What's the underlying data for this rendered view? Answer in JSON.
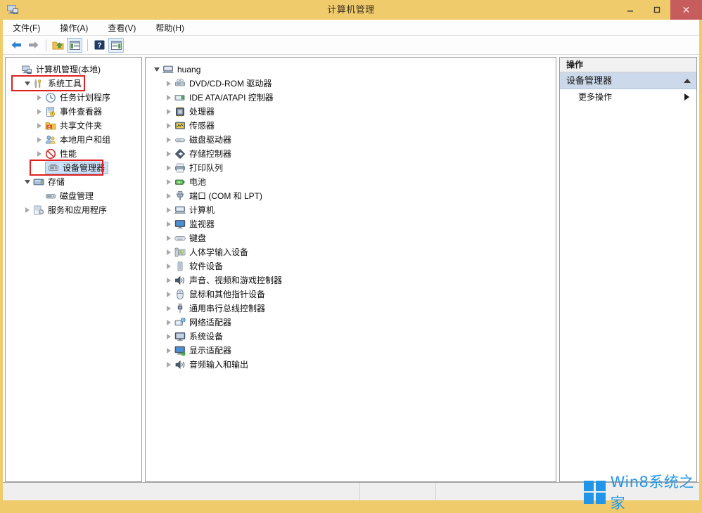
{
  "window": {
    "title": "计算机管理",
    "app_icon": "computer-management-icon",
    "minimize_label": "–",
    "maximize_label": "❐",
    "close_label": "✕",
    "titlebar_color": "#f0cb6b",
    "close_button_color": "#c75c5c"
  },
  "menubar": {
    "items": [
      {
        "label": "文件(F)",
        "name": "menu-file"
      },
      {
        "label": "操作(A)",
        "name": "menu-action"
      },
      {
        "label": "查看(V)",
        "name": "menu-view"
      },
      {
        "label": "帮助(H)",
        "name": "menu-help"
      }
    ]
  },
  "toolbar": {
    "buttons": [
      {
        "icon": "back-arrow-icon",
        "label": ""
      },
      {
        "icon": "forward-arrow-icon",
        "label": ""
      },
      {
        "icon": "up-folder-icon",
        "label": ""
      },
      {
        "icon": "show-hide-tree-icon",
        "label": ""
      },
      {
        "icon": "help-icon",
        "label": ""
      },
      {
        "icon": "show-action-pane-icon",
        "label": ""
      }
    ]
  },
  "tree_left": {
    "root": {
      "label": "计算机管理(本地)",
      "icon": "computer-icon",
      "indent": 0,
      "expander": "none"
    },
    "items": [
      {
        "label": "系统工具",
        "icon": "tools-icon",
        "indent": 1,
        "expander": "expanded",
        "highlight": "red-box"
      },
      {
        "label": "任务计划程序",
        "icon": "clock-icon",
        "indent": 2,
        "expander": "collapsed"
      },
      {
        "label": "事件查看器",
        "icon": "event-viewer-icon",
        "indent": 2,
        "expander": "collapsed"
      },
      {
        "label": "共享文件夹",
        "icon": "shared-folder-icon",
        "indent": 2,
        "expander": "collapsed"
      },
      {
        "label": "本地用户和组",
        "icon": "users-icon",
        "indent": 2,
        "expander": "collapsed"
      },
      {
        "label": "性能",
        "icon": "performance-icon",
        "indent": 2,
        "expander": "collapsed"
      },
      {
        "label": "设备管理器",
        "icon": "device-manager-icon",
        "indent": 2,
        "expander": "none",
        "selected": true,
        "highlight": "red-box"
      },
      {
        "label": "存储",
        "icon": "storage-icon",
        "indent": 1,
        "expander": "expanded"
      },
      {
        "label": "磁盘管理",
        "icon": "disk-management-icon",
        "indent": 2,
        "expander": "none"
      },
      {
        "label": "服务和应用程序",
        "icon": "services-icon",
        "indent": 1,
        "expander": "collapsed"
      }
    ]
  },
  "tree_middle": {
    "root": {
      "label": "huang",
      "icon": "computer-node-icon",
      "indent": 0,
      "expander": "expanded"
    },
    "items": [
      {
        "label": "DVD/CD-ROM 驱动器",
        "icon": "dvd-drive-icon",
        "indent": 1,
        "expander": "collapsed"
      },
      {
        "label": "IDE ATA/ATAPI 控制器",
        "icon": "ide-controller-icon",
        "indent": 1,
        "expander": "collapsed"
      },
      {
        "label": "处理器",
        "icon": "processor-icon",
        "indent": 1,
        "expander": "collapsed"
      },
      {
        "label": "传感器",
        "icon": "sensor-icon",
        "indent": 1,
        "expander": "collapsed"
      },
      {
        "label": "磁盘驱动器",
        "icon": "disk-drive-icon",
        "indent": 1,
        "expander": "collapsed"
      },
      {
        "label": "存储控制器",
        "icon": "storage-controller-icon",
        "indent": 1,
        "expander": "collapsed"
      },
      {
        "label": "打印队列",
        "icon": "printer-icon",
        "indent": 1,
        "expander": "collapsed"
      },
      {
        "label": "电池",
        "icon": "battery-icon",
        "indent": 1,
        "expander": "collapsed"
      },
      {
        "label": "端口 (COM 和 LPT)",
        "icon": "port-icon",
        "indent": 1,
        "expander": "collapsed"
      },
      {
        "label": "计算机",
        "icon": "computer-node-icon",
        "indent": 1,
        "expander": "collapsed"
      },
      {
        "label": "监视器",
        "icon": "monitor-icon",
        "indent": 1,
        "expander": "collapsed"
      },
      {
        "label": "键盘",
        "icon": "keyboard-icon",
        "indent": 1,
        "expander": "collapsed"
      },
      {
        "label": "人体学输入设备",
        "icon": "hid-icon",
        "indent": 1,
        "expander": "collapsed"
      },
      {
        "label": "软件设备",
        "icon": "software-device-icon",
        "indent": 1,
        "expander": "collapsed"
      },
      {
        "label": "声音、视频和游戏控制器",
        "icon": "sound-icon",
        "indent": 1,
        "expander": "collapsed"
      },
      {
        "label": "鼠标和其他指针设备",
        "icon": "mouse-icon",
        "indent": 1,
        "expander": "collapsed"
      },
      {
        "label": "通用串行总线控制器",
        "icon": "usb-icon",
        "indent": 1,
        "expander": "collapsed"
      },
      {
        "label": "网络适配器",
        "icon": "network-adapter-icon",
        "indent": 1,
        "expander": "collapsed"
      },
      {
        "label": "系统设备",
        "icon": "system-device-icon",
        "indent": 1,
        "expander": "collapsed"
      },
      {
        "label": "显示适配器",
        "icon": "display-adapter-icon",
        "indent": 1,
        "expander": "collapsed"
      },
      {
        "label": "音频输入和输出",
        "icon": "audio-io-icon",
        "indent": 1,
        "expander": "collapsed"
      }
    ]
  },
  "actions": {
    "header": "操作",
    "group_title": "设备管理器",
    "group_collapse_icon": "caret-up-icon",
    "items": [
      {
        "label": "更多操作",
        "submenu_icon": "caret-right-icon"
      }
    ]
  },
  "statusbar": {
    "text": ""
  },
  "watermark": {
    "text": "Win8系统之家",
    "logo": "windows-logo-icon",
    "color": "#2196e8"
  }
}
